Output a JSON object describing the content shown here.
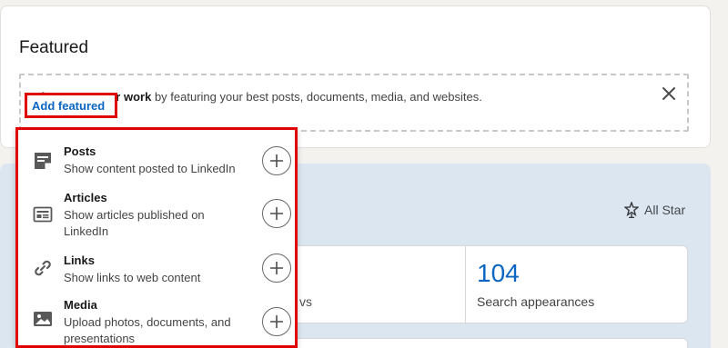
{
  "featured": {
    "title": "Featured",
    "showcase_bold": "Showcase your work",
    "showcase_rest": " by featuring your best posts, documents, media, and websites.",
    "add_featured": "Add featured"
  },
  "menu": {
    "items": [
      {
        "title": "Posts",
        "desc": "Show content posted to LinkedIn",
        "icon": "post-icon"
      },
      {
        "title": "Articles",
        "desc": "Show articles published on LinkedIn",
        "icon": "article-icon"
      },
      {
        "title": "Links",
        "desc": "Show links to web content",
        "icon": "link-icon"
      },
      {
        "title": "Media",
        "desc": "Upload photos, documents, and presentations",
        "icon": "media-icon"
      }
    ]
  },
  "analytics": {
    "all_star": "All Star",
    "left_partial": "vs",
    "search_number": "104",
    "search_label": "Search appearances"
  },
  "colors": {
    "accent": "#0a66c2",
    "highlight": "#e00000"
  }
}
